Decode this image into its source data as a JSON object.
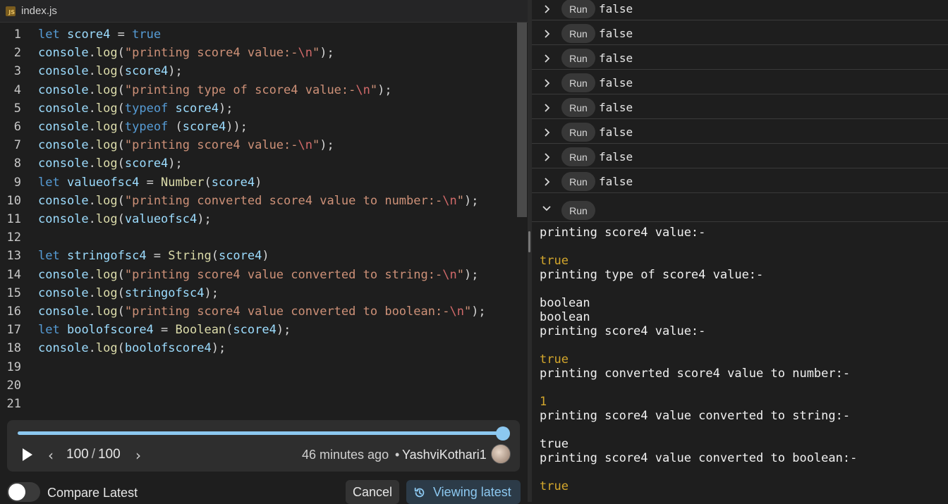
{
  "editor": {
    "file_name": "index.js",
    "file_icon_label": "JS",
    "line_numbers": [
      "1",
      "2",
      "3",
      "4",
      "5",
      "6",
      "7",
      "8",
      "9",
      "10",
      "11",
      "12",
      "13",
      "14",
      "15",
      "16",
      "17",
      "18",
      "19",
      "20",
      "21"
    ],
    "lines": [
      "let score4 = true",
      "console.log(\"printing score4 value:-\\n\");",
      "console.log(score4);",
      "console.log(\"printing type of score4 value:-\\n\");",
      "console.log(typeof score4);",
      "console.log(typeof (score4));",
      "console.log(\"printing score4 value:-\\n\");",
      "console.log(score4);",
      "let valueofsc4 = Number(score4)",
      "console.log(\"printing converted score4 value to number:-\\n\");",
      "console.log(valueofsc4);",
      "",
      "let stringofsc4 = String(score4)",
      "console.log(\"printing score4 value converted to string:-\\n\");",
      "console.log(stringofsc4);",
      "console.log(\"printing score4 value converted to boolean:-\\n\");",
      "let boolofscore4 = Boolean(score4);",
      "console.log(boolofscore4);",
      "",
      "",
      ""
    ]
  },
  "history": {
    "progress": 1.0,
    "current": "100",
    "separator": "/",
    "total": "100",
    "time_ago": "46 minutes ago",
    "bullet": "•",
    "author": "YashviKothari1"
  },
  "bottom": {
    "compare_label": "Compare Latest",
    "compare_on": false,
    "cancel_label": "Cancel",
    "viewing_label": "Viewing latest"
  },
  "console": {
    "run_label": "Run",
    "collapsed_runs": [
      "false",
      "false",
      "false",
      "false",
      "false",
      "false",
      "false",
      "false"
    ],
    "output": [
      {
        "text": "printing score4 value:-",
        "type": "log"
      },
      {
        "text": "",
        "type": "log"
      },
      {
        "text": "true",
        "type": "value"
      },
      {
        "text": "printing type of score4 value:-",
        "type": "log"
      },
      {
        "text": "",
        "type": "log"
      },
      {
        "text": "boolean",
        "type": "log"
      },
      {
        "text": "boolean",
        "type": "log"
      },
      {
        "text": "printing score4 value:-",
        "type": "log"
      },
      {
        "text": "",
        "type": "log"
      },
      {
        "text": "true",
        "type": "value"
      },
      {
        "text": "printing converted score4 value to number:-",
        "type": "log"
      },
      {
        "text": "",
        "type": "log"
      },
      {
        "text": "1",
        "type": "value"
      },
      {
        "text": "printing score4 value converted to string:-",
        "type": "log"
      },
      {
        "text": "",
        "type": "log"
      },
      {
        "text": "true",
        "type": "log"
      },
      {
        "text": "printing score4 value converted to boolean:-",
        "type": "log"
      },
      {
        "text": "",
        "type": "log"
      },
      {
        "text": "true",
        "type": "value"
      }
    ]
  },
  "colors": {
    "accent": "#8cc8f0",
    "value_yellow": "#d4a72c",
    "background": "#1e1e1e"
  },
  "icons": [
    "js-file-icon",
    "play-icon",
    "chevron-left-icon",
    "chevron-right-icon",
    "avatar",
    "history-icon",
    "chevron-right-icon",
    "chevron-down-icon"
  ]
}
